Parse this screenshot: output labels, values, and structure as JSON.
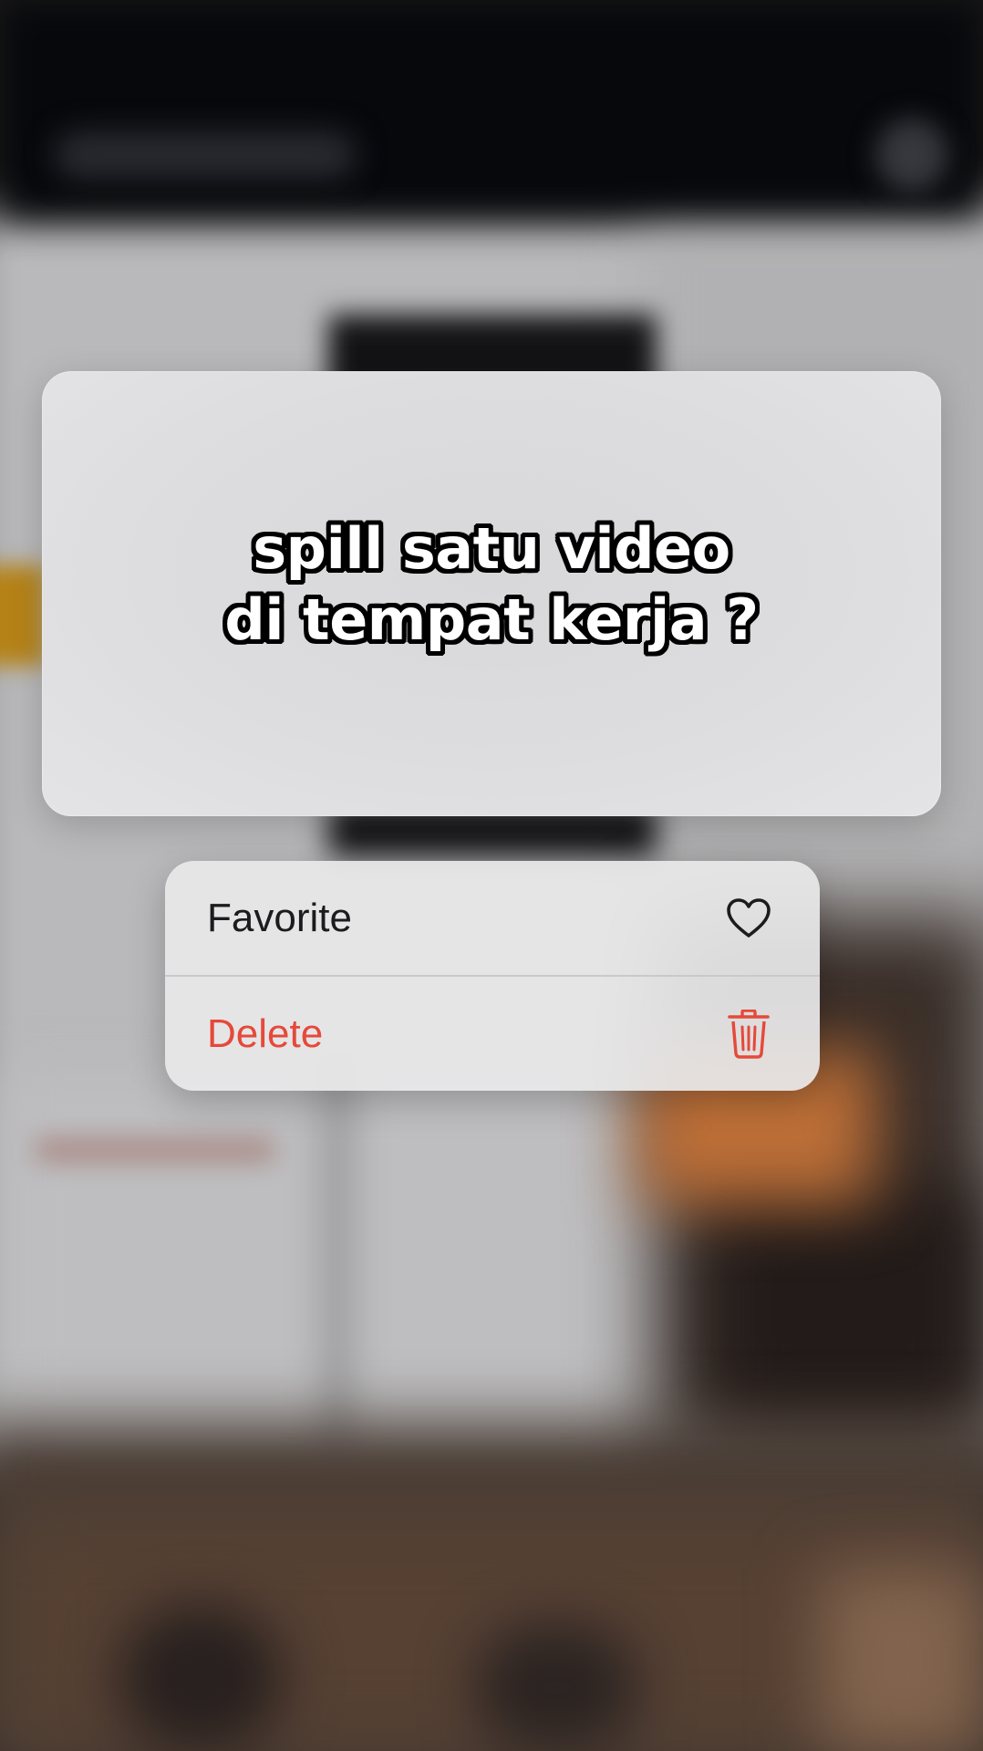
{
  "preview": {
    "caption_line1": "spill satu video",
    "caption_line2": "di tempat kerja ?"
  },
  "context_menu": {
    "items": [
      {
        "label": "Favorite",
        "icon": "heart-icon",
        "color": "#1c1c1e"
      },
      {
        "label": "Delete",
        "icon": "trash-icon",
        "color": "#e5493a"
      }
    ]
  }
}
